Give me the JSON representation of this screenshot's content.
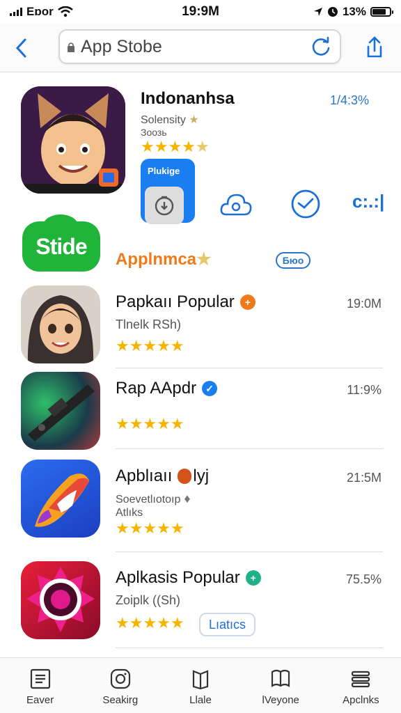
{
  "status_bar": {
    "carrier": "Eɒor",
    "time": "19:9M",
    "battery_percent": "13%",
    "battery_level": 0.8
  },
  "address_bar": {
    "url": "App Stobe",
    "icons": [
      "chevron-left-icon",
      "lock-icon",
      "reload-icon",
      "share-icon"
    ]
  },
  "featured": {
    "name": "Indonanhsa",
    "subtitle": "Solensity",
    "subtitle2": "Зоозь",
    "rating": "1/4:3%",
    "stars": 4.5,
    "chip_label": "Plukige",
    "actions": [
      "download-icon",
      "cloud-icon",
      "clock-icon"
    ],
    "more_label": "c:.:|"
  },
  "banner": {
    "badge_text": "Stide",
    "label": "Applnmca",
    "pill_text": "Бюо"
  },
  "list": [
    {
      "name": "Papkaıı Popular",
      "badge_color": "#f07a1a",
      "badge_glyph": "+",
      "subtitle": "Tlnelk RSh)",
      "subtitle2": "",
      "right": "19:0M",
      "stars": 5
    },
    {
      "name": "Rap AApdr",
      "badge_color": "#1a7ef0",
      "badge_glyph": "✓",
      "subtitle": "",
      "subtitle2": "",
      "right": "11:9%",
      "stars": 5
    },
    {
      "name": "Apblıaıı",
      "name_suffix": "lyj",
      "badge_color": "#d2541a",
      "badge_glyph": "",
      "subtitle": "Soevetlıotoıр",
      "subtitle2": "Atlıks",
      "right": "21:5M",
      "stars": 5
    },
    {
      "name": "Aplkasis Popular",
      "badge_color": "#20b08a",
      "badge_glyph": "+",
      "subtitle": "Zoiplk ((Sh)",
      "subtitle2": "",
      "right": "75.5%",
      "stars": 5,
      "chip": "Lıatıcs"
    }
  ],
  "tabs": [
    {
      "label": "Eaver",
      "icon": "list-icon"
    },
    {
      "label": "Seakirg",
      "icon": "search-camera-icon"
    },
    {
      "label": "Llale",
      "icon": "book-icon"
    },
    {
      "label": "lVeyone",
      "icon": "library-icon"
    },
    {
      "label": "Apclnks",
      "icon": "stack-icon"
    }
  ],
  "colors": {
    "accent": "#1a6fd8",
    "star": "#f4b400",
    "green": "#20b53a",
    "orange": "#f07a1a"
  }
}
